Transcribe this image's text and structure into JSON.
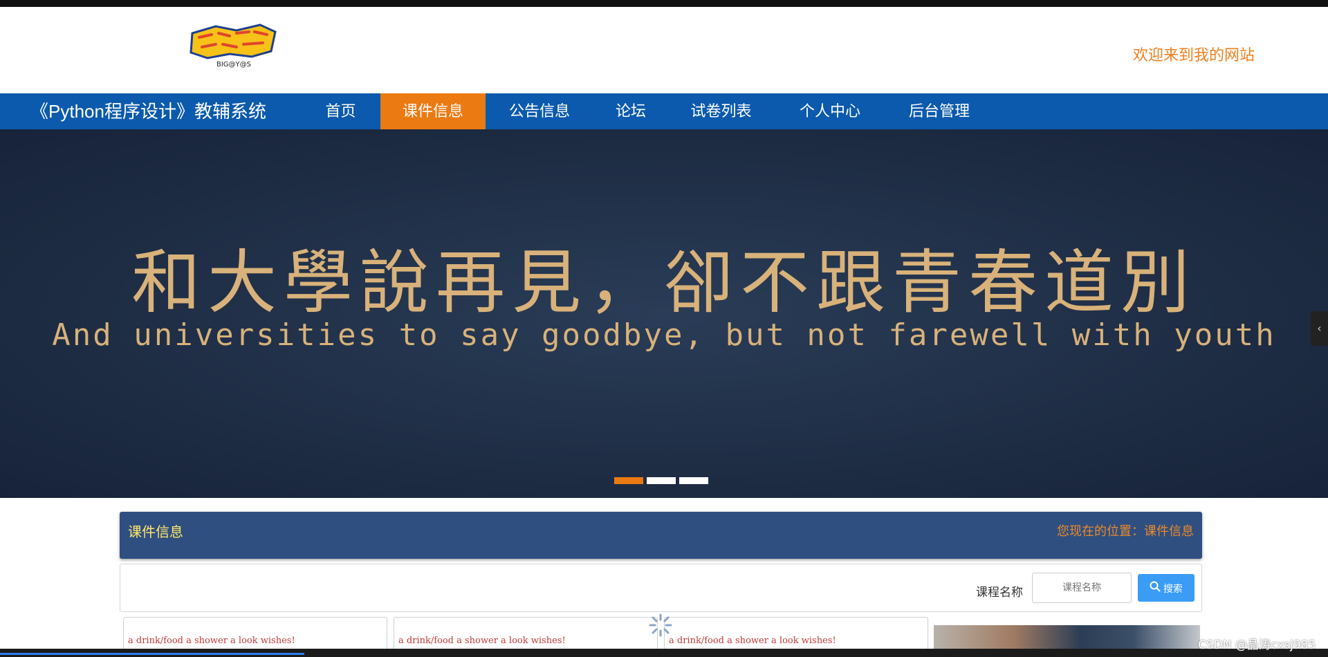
{
  "header": {
    "logo_text": "BIG@Y@S",
    "welcome": "欢迎来到我的网站"
  },
  "nav": {
    "site_title": "《Python程序设计》教辅系统",
    "items": [
      {
        "label": "首页"
      },
      {
        "label": "课件信息",
        "active": true
      },
      {
        "label": "公告信息"
      },
      {
        "label": "论坛"
      },
      {
        "label": "试卷列表"
      },
      {
        "label": "个人中心"
      },
      {
        "label": "后台管理"
      }
    ]
  },
  "banner": {
    "headline_cn": "和大學說再見，卻不跟青春道別",
    "headline_en": "And universities to say goodbye, but not farewell with youth",
    "active_slide": 1,
    "slide_count": 3
  },
  "breadcrumb": {
    "title": "课件信息",
    "location": "您现在的位置：课件信息"
  },
  "search": {
    "label": "课程名称",
    "placeholder": "课程名称",
    "button": "搜索"
  },
  "cards": [
    {
      "text": "a drink/food    a shower    a look        wishes!"
    },
    {
      "text": "a drink/food    a shower    a look        wishes!"
    },
    {
      "text": "a drink/food    a shower    a look        wishes!"
    }
  ],
  "watermark": "CSDN @晶涛cxsj985",
  "colors": {
    "nav_bg": "#0b5aad",
    "accent": "#ec7a12",
    "crumb_bg": "#2f4f80",
    "search_btn": "#3a9cf5"
  }
}
